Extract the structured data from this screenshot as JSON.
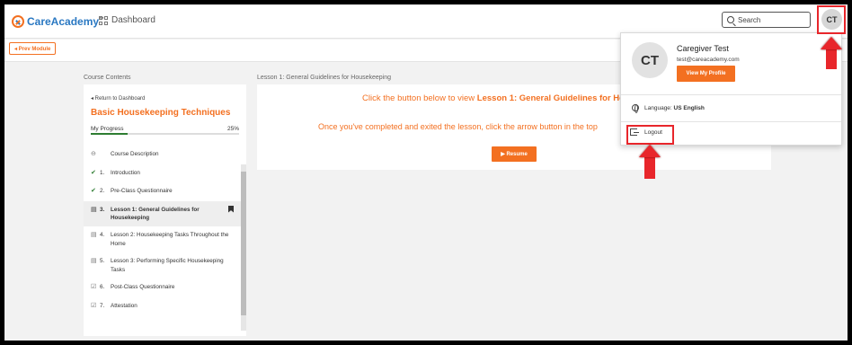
{
  "header": {
    "logo_text": "CareAcademy",
    "logo_tm": "™",
    "dashboard_label": "Dashboard",
    "search_placeholder": "Search",
    "avatar_initials": "CT"
  },
  "prev_module_label": "◂ Prev Module",
  "course_contents_label": "Course Contents",
  "lesson_heading": "Lesson 1: General Guidelines for Housekeeping",
  "sidebar": {
    "back_label": "◂ Return to Dashboard",
    "course_title": "Basic Housekeeping Techniques",
    "progress_label": "My Progress",
    "progress_pct": "25%",
    "progress_value": 0.25,
    "items": [
      {
        "icon": "info-icon",
        "num": "",
        "label": "Course Description",
        "status": "none"
      },
      {
        "icon": "check-icon",
        "num": "1.",
        "label": "Introduction",
        "status": "complete"
      },
      {
        "icon": "check-icon",
        "num": "2.",
        "label": "Pre-Class Questionnaire",
        "status": "complete"
      },
      {
        "icon": "lesson-icon",
        "num": "3.",
        "label": "Lesson 1: General Guidelines for Housekeeping",
        "status": "active"
      },
      {
        "icon": "lesson-icon",
        "num": "4.",
        "label": "Lesson 2: Housekeeping Tasks Throughout the Home",
        "status": "none"
      },
      {
        "icon": "lesson-icon",
        "num": "5.",
        "label": "Lesson 3: Performing Specific Housekeeping Tasks",
        "status": "none"
      },
      {
        "icon": "checkbox-icon",
        "num": "6.",
        "label": "Post-Class Questionnaire",
        "status": "none"
      },
      {
        "icon": "checkbox-icon",
        "num": "7.",
        "label": "Attestation",
        "status": "none"
      }
    ]
  },
  "main": {
    "line1_prefix": "Click the button below to view ",
    "line1_bold": "Lesson 1: General Guidelines for Hou",
    "line2": "Once you've completed and exited the lesson, click the arrow button in the top",
    "resume_label": "▶ Resume"
  },
  "dropdown": {
    "avatar_initials": "CT",
    "name": "Caregiver Test",
    "email": "test@careacademy.com",
    "view_profile_label": "View My Profile",
    "language_prefix": "Language: ",
    "language_value": "US English",
    "logout_label": "Logout"
  },
  "colors": {
    "accent": "#f37021",
    "brand_blue": "#2a78c2",
    "annotation_red": "#e8262b",
    "progress_green": "#2e7d32"
  }
}
